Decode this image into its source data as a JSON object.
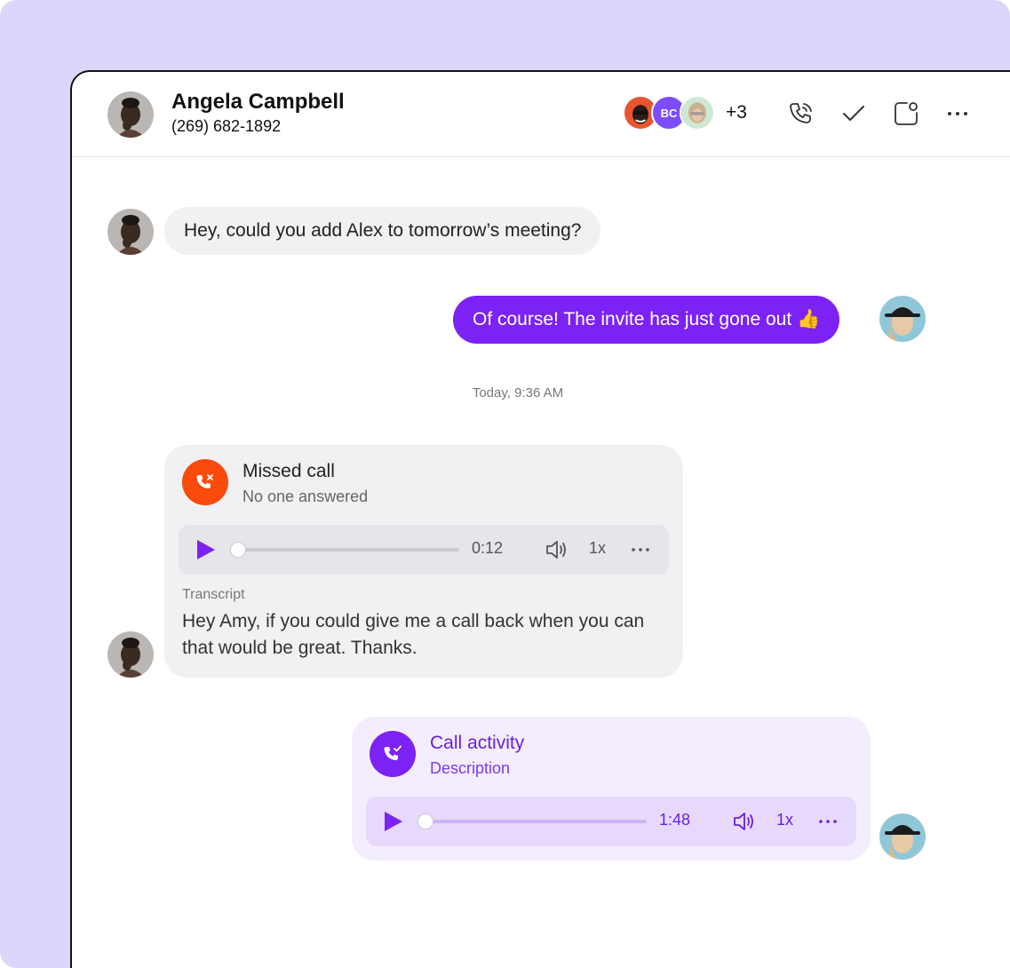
{
  "contact": {
    "name": "Angela Campbell",
    "phone": "(269) 682-1892"
  },
  "participants": {
    "initials": "BC",
    "extra_count": "+3"
  },
  "header_actions": [
    "phone-icon",
    "check-icon",
    "panel-icon",
    "more-icon"
  ],
  "messages": [
    {
      "direction": "incoming",
      "text": "Hey, could you add Alex to tomorrow’s meeting?"
    },
    {
      "direction": "outgoing",
      "text": "Of course! The invite has just gone out 👍"
    }
  ],
  "timestamp": "Today, 9:36 AM",
  "missed_call": {
    "title": "Missed call",
    "subtitle": "No one answered",
    "duration": "0:12",
    "progress": 0,
    "speed": "1x",
    "transcript_label": "Transcript",
    "transcript": "Hey Amy, if you could give me a call back when you can that would be great. Thanks."
  },
  "call_activity": {
    "title": "Call activity",
    "subtitle": "Description",
    "duration": "1:48",
    "progress": 0,
    "speed": "1x"
  },
  "colors": {
    "accent": "#7c22f5",
    "missed": "#fa4a0c",
    "frame": "#ddd6fb"
  }
}
